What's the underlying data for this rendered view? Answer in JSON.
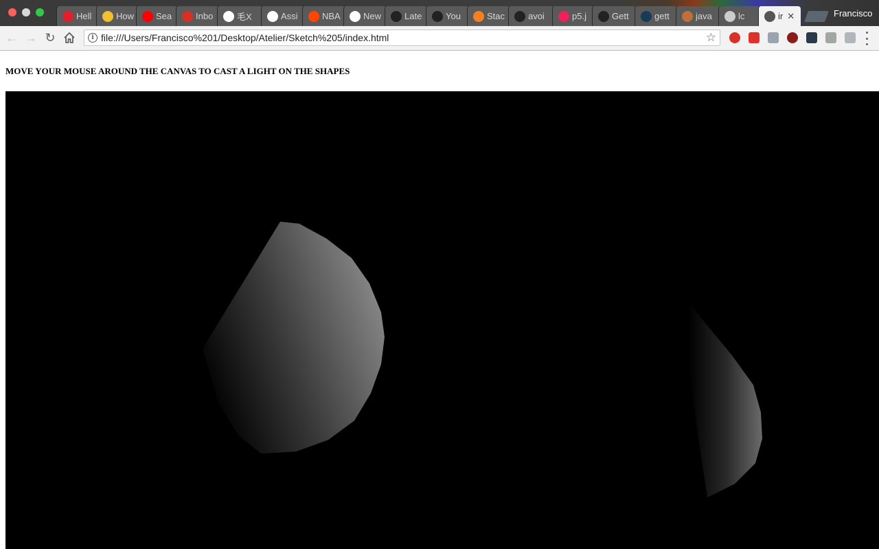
{
  "browser": {
    "tabs": [
      {
        "label": "Hell",
        "icon": "opera-icon",
        "color": "#e0202a"
      },
      {
        "label": "How",
        "icon": "globe-icon",
        "color": "#f0c030"
      },
      {
        "label": "Sea",
        "icon": "youtube-icon",
        "color": "#ff0000"
      },
      {
        "label": "Inbo",
        "icon": "gmail-icon",
        "color": "#d93025"
      },
      {
        "label": "毛X",
        "icon": "google-icon",
        "color": "#ffffff"
      },
      {
        "label": "Assi",
        "icon": "atelier-icon",
        "color": "#ffffff"
      },
      {
        "label": "NBA",
        "icon": "reddit-icon",
        "color": "#ff4500"
      },
      {
        "label": "New",
        "icon": "circle-icon",
        "color": "#ffffff"
      },
      {
        "label": "Late",
        "icon": "quora-icon",
        "color": "#222222"
      },
      {
        "label": "You",
        "icon": "github-icon",
        "color": "#222222"
      },
      {
        "label": "Stac",
        "icon": "stackoverflow-icon",
        "color": "#f48024"
      },
      {
        "label": "avoi",
        "icon": "github-icon",
        "color": "#222222"
      },
      {
        "label": "p5.j",
        "icon": "p5-icon",
        "color": "#ed225d"
      },
      {
        "label": "Gett",
        "icon": "github-icon",
        "color": "#222222"
      },
      {
        "label": "gett",
        "icon": "p-icon",
        "color": "#1a3a5a"
      },
      {
        "label": "java",
        "icon": "pen-icon",
        "color": "#c0703a"
      },
      {
        "label": "lc",
        "icon": "page-icon",
        "color": "#cccccc"
      },
      {
        "label": "ir",
        "icon": "page-icon",
        "color": "#555555",
        "active": true
      }
    ],
    "profile_name": "Francisco",
    "url": "file:///Users/Francisco%201/Desktop/Atelier/Sketch%205/index.html",
    "extensions": [
      {
        "icon": "adblock-icon",
        "color": "#d9302a"
      },
      {
        "icon": "video-speed-icon",
        "color": "#e0302a"
      },
      {
        "icon": "text-extension-icon",
        "color": "#9aa4ae"
      },
      {
        "icon": "ublock-icon",
        "color": "#8b1a1a"
      },
      {
        "icon": "moon-extension-icon",
        "color": "#2a3a4a"
      },
      {
        "icon": "h-extension-icon",
        "color": "#a0a8a0"
      },
      {
        "icon": "mail-extension-icon",
        "color": "#b0b6bc"
      }
    ]
  },
  "page": {
    "instruction": "MOVE YOUR MOUSE AROUND THE CANVAS TO CAST A LIGHT ON THE SHAPES"
  }
}
